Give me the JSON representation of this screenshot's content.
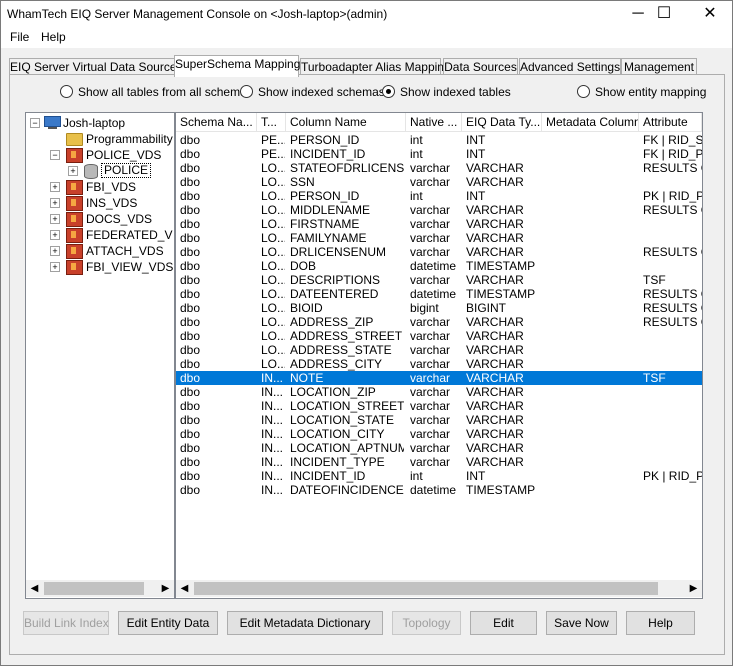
{
  "window": {
    "title": "WhamTech EIQ Server Management Console on <Josh-laptop>(admin)",
    "minimize_glyph": "─",
    "maximize_glyph": "☐",
    "close_glyph": "✕"
  },
  "menu": {
    "items": [
      "File",
      "Help"
    ]
  },
  "tabs": [
    {
      "label": "EIQ Server Virtual Data Sources",
      "active": false
    },
    {
      "label": "SuperSchema Mapping",
      "active": true
    },
    {
      "label": "Turboadapter Alias Mapping",
      "active": false
    },
    {
      "label": "Data Sources",
      "active": false
    },
    {
      "label": "Advanced Settings",
      "active": false
    },
    {
      "label": "Management",
      "active": false
    }
  ],
  "radios": [
    {
      "label": "Show all tables from all schemas",
      "checked": false
    },
    {
      "label": "Show indexed schemas",
      "checked": false
    },
    {
      "label": "Show indexed tables",
      "checked": true
    },
    {
      "label": "Show entity mapping",
      "checked": false
    }
  ],
  "tree": {
    "root": "Josh-laptop",
    "nodes": [
      {
        "label": "Programmability",
        "icon": "folder-icon"
      },
      {
        "label": "POLICE_VDS",
        "icon": "vds-icon",
        "expanded": true
      },
      {
        "label": "POLICE",
        "icon": "database-icon"
      },
      {
        "label": "FBI_VDS",
        "icon": "vds-icon"
      },
      {
        "label": "INS_VDS",
        "icon": "vds-icon"
      },
      {
        "label": "DOCS_VDS",
        "icon": "vds-icon"
      },
      {
        "label": "FEDERATED_V",
        "icon": "vds-icon"
      },
      {
        "label": "ATTACH_VDS",
        "icon": "vds-icon"
      },
      {
        "label": "FBI_VIEW_VDS",
        "icon": "vds-icon"
      }
    ]
  },
  "grid": {
    "columns": [
      "Schema Na...",
      "T...",
      "Column Name",
      "Native ...",
      "EIQ Data Ty...",
      "Metadata Column",
      "Attribute"
    ],
    "selected_row": 17,
    "rows": [
      [
        "dbo",
        "PE...",
        "PERSON_ID",
        "int",
        "INT",
        "",
        "FK | RID_SE"
      ],
      [
        "dbo",
        "PE...",
        "INCIDENT_ID",
        "int",
        "INT",
        "",
        "FK | RID_PR"
      ],
      [
        "dbo",
        "LO...",
        "STATEOFDRLICENSE",
        "varchar",
        "VARCHAR",
        "",
        "RESULTS C"
      ],
      [
        "dbo",
        "LO...",
        "SSN",
        "varchar",
        "VARCHAR",
        "",
        ""
      ],
      [
        "dbo",
        "LO...",
        "PERSON_ID",
        "int",
        "INT",
        "",
        "PK | RID_PF"
      ],
      [
        "dbo",
        "LO...",
        "MIDDLENAME",
        "varchar",
        "VARCHAR",
        "",
        "RESULTS C"
      ],
      [
        "dbo",
        "LO...",
        "FIRSTNAME",
        "varchar",
        "VARCHAR",
        "",
        ""
      ],
      [
        "dbo",
        "LO...",
        "FAMILYNAME",
        "varchar",
        "VARCHAR",
        "",
        ""
      ],
      [
        "dbo",
        "LO...",
        "DRLICENSENUM",
        "varchar",
        "VARCHAR",
        "",
        "RESULTS C"
      ],
      [
        "dbo",
        "LO...",
        "DOB",
        "datetime",
        "TIMESTAMP",
        "",
        ""
      ],
      [
        "dbo",
        "LO...",
        "DESCRIPTIONS",
        "varchar",
        "VARCHAR",
        "",
        "TSF"
      ],
      [
        "dbo",
        "LO...",
        "DATEENTERED",
        "datetime",
        "TIMESTAMP",
        "",
        "RESULTS C"
      ],
      [
        "dbo",
        "LO...",
        "BIOID",
        "bigint",
        "BIGINT",
        "",
        "RESULTS C"
      ],
      [
        "dbo",
        "LO...",
        "ADDRESS_ZIP",
        "varchar",
        "VARCHAR",
        "",
        "RESULTS C"
      ],
      [
        "dbo",
        "LO...",
        "ADDRESS_STREET",
        "varchar",
        "VARCHAR",
        "",
        ""
      ],
      [
        "dbo",
        "LO...",
        "ADDRESS_STATE",
        "varchar",
        "VARCHAR",
        "",
        ""
      ],
      [
        "dbo",
        "LO...",
        "ADDRESS_CITY",
        "varchar",
        "VARCHAR",
        "",
        ""
      ],
      [
        "dbo",
        "IN...",
        "NOTE",
        "varchar",
        "VARCHAR",
        "",
        "TSF"
      ],
      [
        "dbo",
        "IN...",
        "LOCATION_ZIP",
        "varchar",
        "VARCHAR",
        "",
        ""
      ],
      [
        "dbo",
        "IN...",
        "LOCATION_STREET",
        "varchar",
        "VARCHAR",
        "",
        ""
      ],
      [
        "dbo",
        "IN...",
        "LOCATION_STATE",
        "varchar",
        "VARCHAR",
        "",
        ""
      ],
      [
        "dbo",
        "IN...",
        "LOCATION_CITY",
        "varchar",
        "VARCHAR",
        "",
        ""
      ],
      [
        "dbo",
        "IN...",
        "LOCATION_APTNUM",
        "varchar",
        "VARCHAR",
        "",
        ""
      ],
      [
        "dbo",
        "IN...",
        "INCIDENT_TYPE",
        "varchar",
        "VARCHAR",
        "",
        ""
      ],
      [
        "dbo",
        "IN...",
        "INCIDENT_ID",
        "int",
        "INT",
        "",
        "PK | RID_PF"
      ],
      [
        "dbo",
        "IN...",
        "DATEOFINCIDENCE",
        "datetime",
        "TIMESTAMP",
        "",
        ""
      ]
    ]
  },
  "scroll": {
    "left": "◀",
    "right": "▶"
  },
  "buttons": [
    {
      "label": "Build Link Index",
      "enabled": false,
      "name": "build-link-index-button"
    },
    {
      "label": "Edit Entity Data",
      "enabled": true,
      "name": "edit-entity-data-button"
    },
    {
      "label": "Edit Metadata Dictionary",
      "enabled": true,
      "name": "edit-metadata-dictionary-button"
    },
    {
      "label": "Topology",
      "enabled": false,
      "name": "topology-button"
    },
    {
      "label": "Edit",
      "enabled": true,
      "name": "edit-button"
    },
    {
      "label": "Save Now",
      "enabled": true,
      "name": "save-now-button"
    },
    {
      "label": "Help",
      "enabled": true,
      "name": "help-button"
    }
  ],
  "colors": {
    "selection": "#0078d7",
    "tab_active": "#ffffff",
    "chrome": "#f0f0f0"
  }
}
